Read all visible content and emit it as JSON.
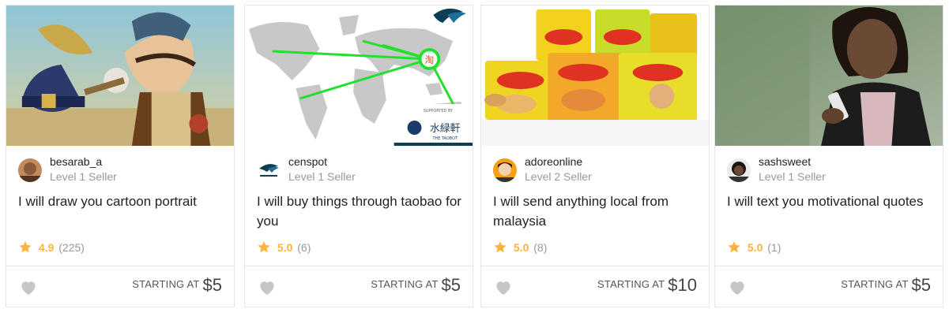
{
  "cards": [
    {
      "seller": "besarab_a",
      "level": "Level 1 Seller",
      "title": "I will draw you cartoon portrait",
      "rating": "4.9",
      "reviews": "(225)",
      "starting_label": "STARTING AT",
      "price": "$5",
      "image": "cartoon-pirate-portrait"
    },
    {
      "seller": "censpot",
      "level": "Level 1 Seller",
      "title": "I will buy things through taobao for you",
      "rating": "5.0",
      "reviews": "(6)",
      "starting_label": "STARTING AT",
      "price": "$5",
      "image": "world-map-taobao",
      "image_text": {
        "badge": "淘",
        "brand": "水緑軒",
        "brand_sub": "THE TAOBOT",
        "supported": "SUPPORTED BY"
      }
    },
    {
      "seller": "adoreonline",
      "level": "Level 2 Seller",
      "title": "I will send anything local from malaysia",
      "rating": "5.0",
      "reviews": "(8)",
      "starting_label": "STARTING AT",
      "price": "$10",
      "image": "instant-noodle-packs"
    },
    {
      "seller": "sashsweet",
      "level": "Level 1 Seller",
      "title": "I will text you motivational quotes",
      "rating": "5.0",
      "reviews": "(1)",
      "starting_label": "STARTING AT",
      "price": "$5",
      "image": "woman-texting-phone"
    }
  ],
  "colors": {
    "star": "#ffb33e",
    "heart": "#c5c6c9",
    "border": "#e4e5e7",
    "level_text": "#999999"
  },
  "icons": {
    "rating": "star-icon",
    "favorite": "heart-icon"
  }
}
